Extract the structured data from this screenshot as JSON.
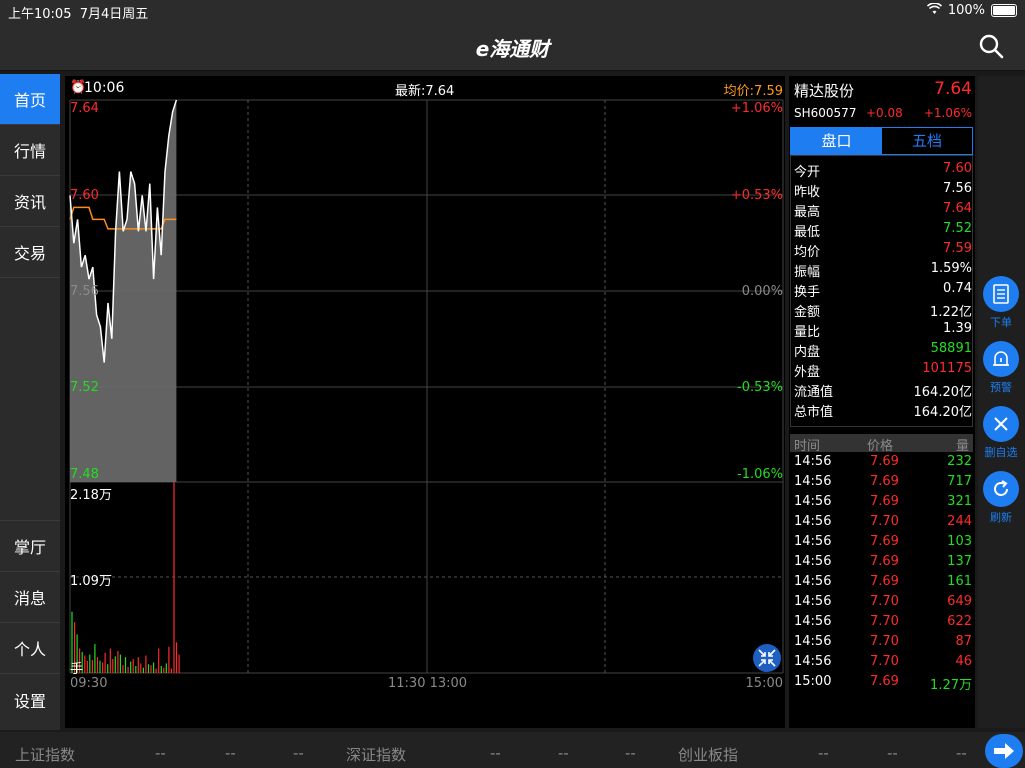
{
  "status_bar": {
    "time": "上午10:05",
    "date": "7月4日周五",
    "battery": "100%"
  },
  "nav": {
    "title": "e海通财"
  },
  "sidebar": {
    "top_items": [
      {
        "label": "首页",
        "active": true
      },
      {
        "label": "行情",
        "active": false
      },
      {
        "label": "资讯",
        "active": false
      },
      {
        "label": "交易",
        "active": false
      }
    ],
    "bottom_items": [
      {
        "label": "掌厅"
      },
      {
        "label": "消息"
      },
      {
        "label": "个人"
      },
      {
        "label": "设置"
      }
    ]
  },
  "chart": {
    "time": "10:06",
    "latest": "最新:7.64",
    "avg": "均价:7.59",
    "price_ticks": [
      "7.64",
      "7.60",
      "7.56",
      "7.52",
      "7.48"
    ],
    "pct_ticks": [
      "+1.06%",
      "+0.53%",
      "0.00%",
      "-0.53%",
      "-1.06%"
    ],
    "vol_ticks": [
      "2.18万",
      "1.09万"
    ],
    "vol_unit": "手",
    "time_ticks": [
      "09:30",
      "11:30 13:00",
      "15:00"
    ]
  },
  "chart_data": {
    "type": "line",
    "title": "",
    "xlabel": "",
    "ylabel": "",
    "ylim": [
      7.48,
      7.64
    ],
    "x_range": [
      "09:30",
      "15:00"
    ],
    "series": [
      {
        "values": [
          7.6,
          7.58,
          7.59,
          7.57,
          7.575,
          7.565,
          7.57,
          7.55,
          7.545,
          7.53,
          7.555,
          7.54,
          7.585,
          7.61,
          7.585,
          7.59,
          7.61,
          7.605,
          7.585,
          7.6,
          7.585,
          7.605,
          7.565,
          7.595,
          7.575,
          7.61,
          7.625,
          7.635,
          7.64
        ]
      },
      {
        "values": [
          7.59,
          7.595,
          7.595,
          7.595,
          7.595,
          7.595,
          7.59,
          7.59,
          7.59,
          7.59,
          7.586,
          7.586,
          7.586,
          7.586,
          7.586,
          7.586,
          7.586,
          7.586,
          7.586,
          7.586,
          7.586,
          7.586,
          7.586,
          7.586,
          7.586,
          7.59,
          7.59,
          7.59,
          7.59
        ]
      }
    ],
    "volume": {
      "ymax": 21800,
      "values": [
        7000,
        5800,
        4400,
        2800,
        2400,
        2000,
        1400,
        2100,
        1500,
        3300,
        1800,
        1400,
        1200,
        2300,
        1000,
        2800,
        1600,
        1900,
        2500,
        2100,
        900,
        1800,
        700,
        1300,
        1600,
        800,
        1800,
        1100,
        600,
        2000,
        1000,
        900,
        1200,
        500,
        2800,
        800,
        600,
        1100,
        3000,
        500,
        21800,
        3500,
        2100
      ],
      "colors": [
        "g",
        "r",
        "g",
        "r",
        "g",
        "r",
        "r",
        "g",
        "r",
        "g",
        "r",
        "g",
        "r",
        "r",
        "g",
        "r",
        "r",
        "g",
        "r",
        "g",
        "r",
        "g",
        "r",
        "g",
        "r",
        "g",
        "r",
        "r",
        "g",
        "r",
        "g",
        "r",
        "g",
        "r",
        "r",
        "g",
        "r",
        "g",
        "r",
        "r",
        "r",
        "r",
        "r"
      ]
    }
  },
  "quote": {
    "name": "精达股份",
    "price": "7.64",
    "code": "SH600577",
    "change": "+0.08",
    "change_pct": "+1.06%",
    "tabs": [
      "盘口",
      "五档"
    ],
    "rows": [
      {
        "k": "今开",
        "v": "7.60",
        "c": "red"
      },
      {
        "k": "昨收",
        "v": "7.56",
        "c": "white"
      },
      {
        "k": "最高",
        "v": "7.64",
        "c": "red"
      },
      {
        "k": "最低",
        "v": "7.52",
        "c": "green"
      },
      {
        "k": "均价",
        "v": "7.59",
        "c": "red"
      },
      {
        "k": "振幅",
        "v": "1.59%",
        "c": "white"
      },
      {
        "k": "换手",
        "v": "0.74",
        "c": "white"
      },
      {
        "k": "金额",
        "v": "1.22亿",
        "c": "white"
      },
      {
        "k": "量比",
        "v": "1.39",
        "c": "white"
      },
      {
        "k": "内盘",
        "v": "58891",
        "c": "green"
      },
      {
        "k": "外盘",
        "v": "101175",
        "c": "red"
      },
      {
        "k": "流通值",
        "v": "164.20亿",
        "c": "white"
      },
      {
        "k": "总市值",
        "v": "164.20亿",
        "c": "white"
      }
    ],
    "trades_header": [
      "时间",
      "价格",
      "量"
    ],
    "trades": [
      {
        "t": "14:56",
        "p": "7.69",
        "q": "232",
        "qc": "green"
      },
      {
        "t": "14:56",
        "p": "7.69",
        "q": "717",
        "qc": "green"
      },
      {
        "t": "14:56",
        "p": "7.69",
        "q": "321",
        "qc": "green"
      },
      {
        "t": "14:56",
        "p": "7.70",
        "q": "244",
        "qc": "red"
      },
      {
        "t": "14:56",
        "p": "7.69",
        "q": "103",
        "qc": "green"
      },
      {
        "t": "14:56",
        "p": "7.69",
        "q": "137",
        "qc": "green"
      },
      {
        "t": "14:56",
        "p": "7.69",
        "q": "161",
        "qc": "green"
      },
      {
        "t": "14:56",
        "p": "7.70",
        "q": "649",
        "qc": "red"
      },
      {
        "t": "14:56",
        "p": "7.70",
        "q": "622",
        "qc": "red"
      },
      {
        "t": "14:56",
        "p": "7.70",
        "q": "87",
        "qc": "red"
      },
      {
        "t": "14:56",
        "p": "7.70",
        "q": "46",
        "qc": "red"
      },
      {
        "t": "15:00",
        "p": "7.69",
        "q": "1.27万",
        "qc": "green"
      }
    ]
  },
  "tools": [
    {
      "label": "下单",
      "icon": "document-icon"
    },
    {
      "label": "预警",
      "icon": "bell-icon"
    },
    {
      "label": "删自选",
      "icon": "close-icon"
    },
    {
      "label": "刷新",
      "icon": "refresh-icon"
    }
  ],
  "index_bar": {
    "items": [
      {
        "name": "上证指数",
        "v1": "--",
        "v2": "--",
        "v3": "--"
      },
      {
        "name": "深证指数",
        "v1": "--",
        "v2": "--",
        "v3": "--"
      },
      {
        "name": "创业板指",
        "v1": "--",
        "v2": "--",
        "v3": "--"
      }
    ]
  }
}
